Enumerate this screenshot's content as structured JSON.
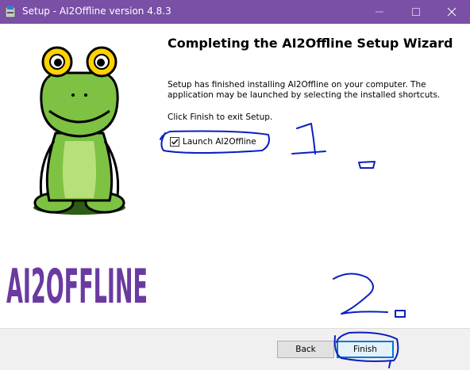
{
  "window": {
    "title": "Setup - AI2Offline version 4.8.3",
    "icon": "installer-icon",
    "controls": [
      "minimize-icon",
      "maximize-icon",
      "close-icon"
    ]
  },
  "left_panel": {
    "mascot": "frog-mascot",
    "logo_text": "AI2OFFLINE"
  },
  "content": {
    "heading": "Completing the AI2Offline Setup Wizard",
    "description": "Setup has finished installing AI2Offline on your computer. The application may be launched by selecting the installed shortcuts.",
    "exit_hint": "Click Finish to exit Setup.",
    "launch_checkbox": {
      "label": "Launch AI2Offline",
      "checked": true
    }
  },
  "buttons": {
    "back": "Back",
    "finish": "Finish"
  },
  "annotations": {
    "marker_1": "1.",
    "marker_2": "2.",
    "ink_color": "#0a1fc0"
  },
  "colors": {
    "titlebar": "#7a4fa6",
    "logo": "#6a3aa0",
    "frog_green": "#7dc242",
    "accent": "#0078d7"
  }
}
